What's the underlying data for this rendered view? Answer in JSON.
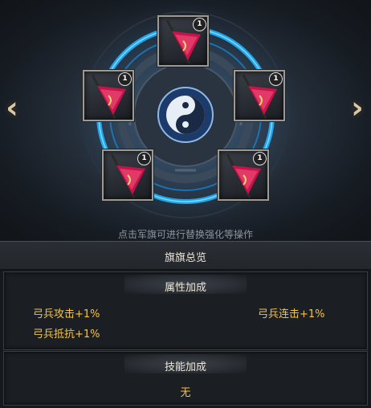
{
  "hint_text": "点击军旗可进行替换强化等操作",
  "overview": {
    "title": "旗旗总览"
  },
  "attributes": {
    "title": "属性加成",
    "stats": [
      {
        "label": "弓兵攻击+1%"
      },
      {
        "label": "弓兵连击+1%"
      },
      {
        "label": "弓兵抵抗+1%"
      }
    ]
  },
  "skills": {
    "title": "技能加成",
    "value": "无"
  },
  "flag_slots": [
    {
      "level": "1"
    },
    {
      "level": "1"
    },
    {
      "level": "1"
    },
    {
      "level": "1"
    },
    {
      "level": "1"
    }
  ],
  "nav": {
    "left": "‹",
    "right": "›"
  },
  "colors": {
    "accent_gold": "#f3c44a",
    "ring_blue": "#1fb3ff",
    "flag_red": "#c8134a"
  }
}
